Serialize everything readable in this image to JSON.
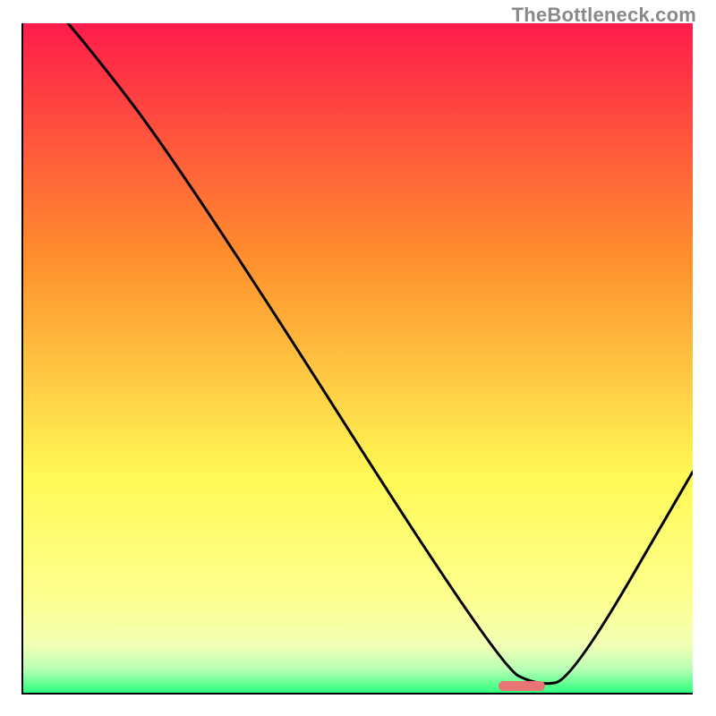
{
  "watermark": "TheBottleneck.com",
  "colors": {
    "top": "#fe1c4b",
    "mid_upper": "#ff8f2d",
    "mid": "#fffa56",
    "mid_lower": "#fdff8f",
    "band_light": "#f2ffb6",
    "green_light": "#b7ffb6",
    "green": "#2dff7a",
    "axis": "#000000",
    "line": "#000000",
    "marker": "#e87476",
    "watermark": "#88898a"
  },
  "chart_data": {
    "type": "line",
    "title": "",
    "xlabel": "",
    "ylabel": "",
    "xlim": [
      0,
      100
    ],
    "ylim": [
      0,
      100
    ],
    "x": [
      0,
      7,
      24,
      71,
      77,
      82,
      100
    ],
    "values": [
      107,
      100,
      78,
      4,
      1,
      2,
      33
    ],
    "marker": {
      "x_start": 71,
      "x_end": 78,
      "y": 1
    },
    "gradient_stops": [
      {
        "offset": 0.0,
        "color": "#fe1c4b"
      },
      {
        "offset": 0.35,
        "color": "#ff8f2d"
      },
      {
        "offset": 0.68,
        "color": "#fffa56"
      },
      {
        "offset": 0.86,
        "color": "#fdff8f"
      },
      {
        "offset": 0.93,
        "color": "#f2ffb6"
      },
      {
        "offset": 0.965,
        "color": "#b7ffb6"
      },
      {
        "offset": 1.0,
        "color": "#2dff7a"
      }
    ]
  }
}
